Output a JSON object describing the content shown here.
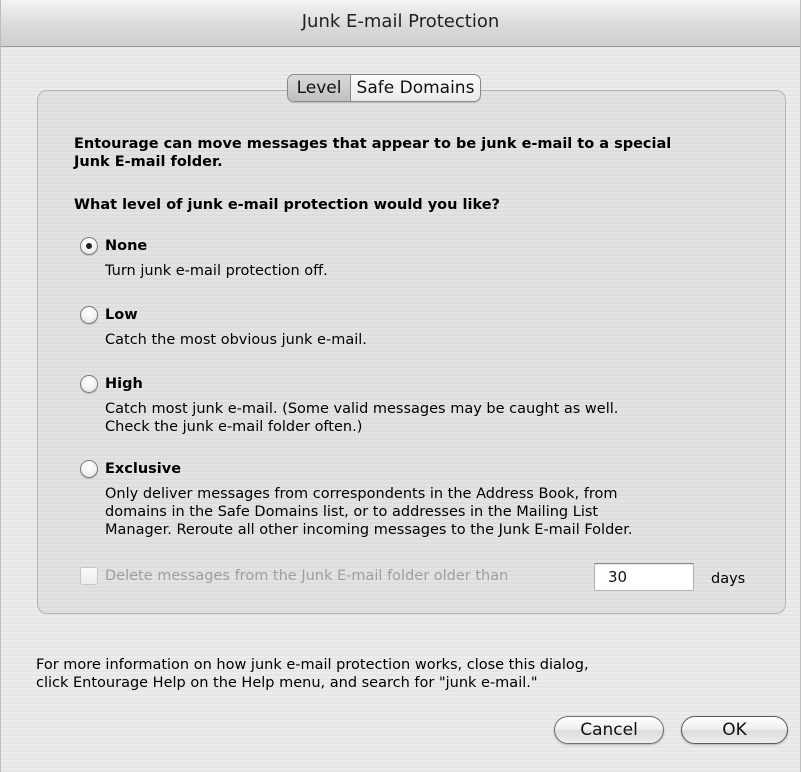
{
  "window": {
    "title": "Junk E-mail Protection"
  },
  "tabs": [
    {
      "label": "Level",
      "selected": true
    },
    {
      "label": "Safe Domains",
      "selected": false
    }
  ],
  "intro": {
    "line1": "Entourage can move messages that appear to be junk e-mail to a special",
    "line2": "Junk E-mail folder."
  },
  "question": "What level of junk e-mail protection would you like?",
  "options": [
    {
      "label": "None",
      "selected": true,
      "description": [
        "Turn junk e-mail protection off."
      ]
    },
    {
      "label": "Low",
      "selected": false,
      "description": [
        "Catch the most obvious junk e-mail."
      ]
    },
    {
      "label": "High",
      "selected": false,
      "description": [
        "Catch most junk e-mail.  (Some valid messages may be caught as well.",
        "Check the junk e-mail folder often.)"
      ]
    },
    {
      "label": "Exclusive",
      "selected": false,
      "description": [
        "Only deliver messages from correspondents in the Address Book, from",
        "domains in the Safe Domains list, or to addresses in the Mailing List",
        "Manager.  Reroute all other incoming messages to the Junk E-mail Folder."
      ]
    }
  ],
  "delete_option": {
    "label": "Delete messages from the Junk E-mail folder older than",
    "checked": false,
    "enabled": false,
    "days_value": "30",
    "days_unit": "days"
  },
  "footer": {
    "line1": "For more information on how junk e-mail protection works, close this dialog,",
    "line2": "click Entourage Help on the Help menu, and search for \"junk e-mail.\""
  },
  "buttons": {
    "cancel_label": "Cancel",
    "ok_label": "OK"
  }
}
